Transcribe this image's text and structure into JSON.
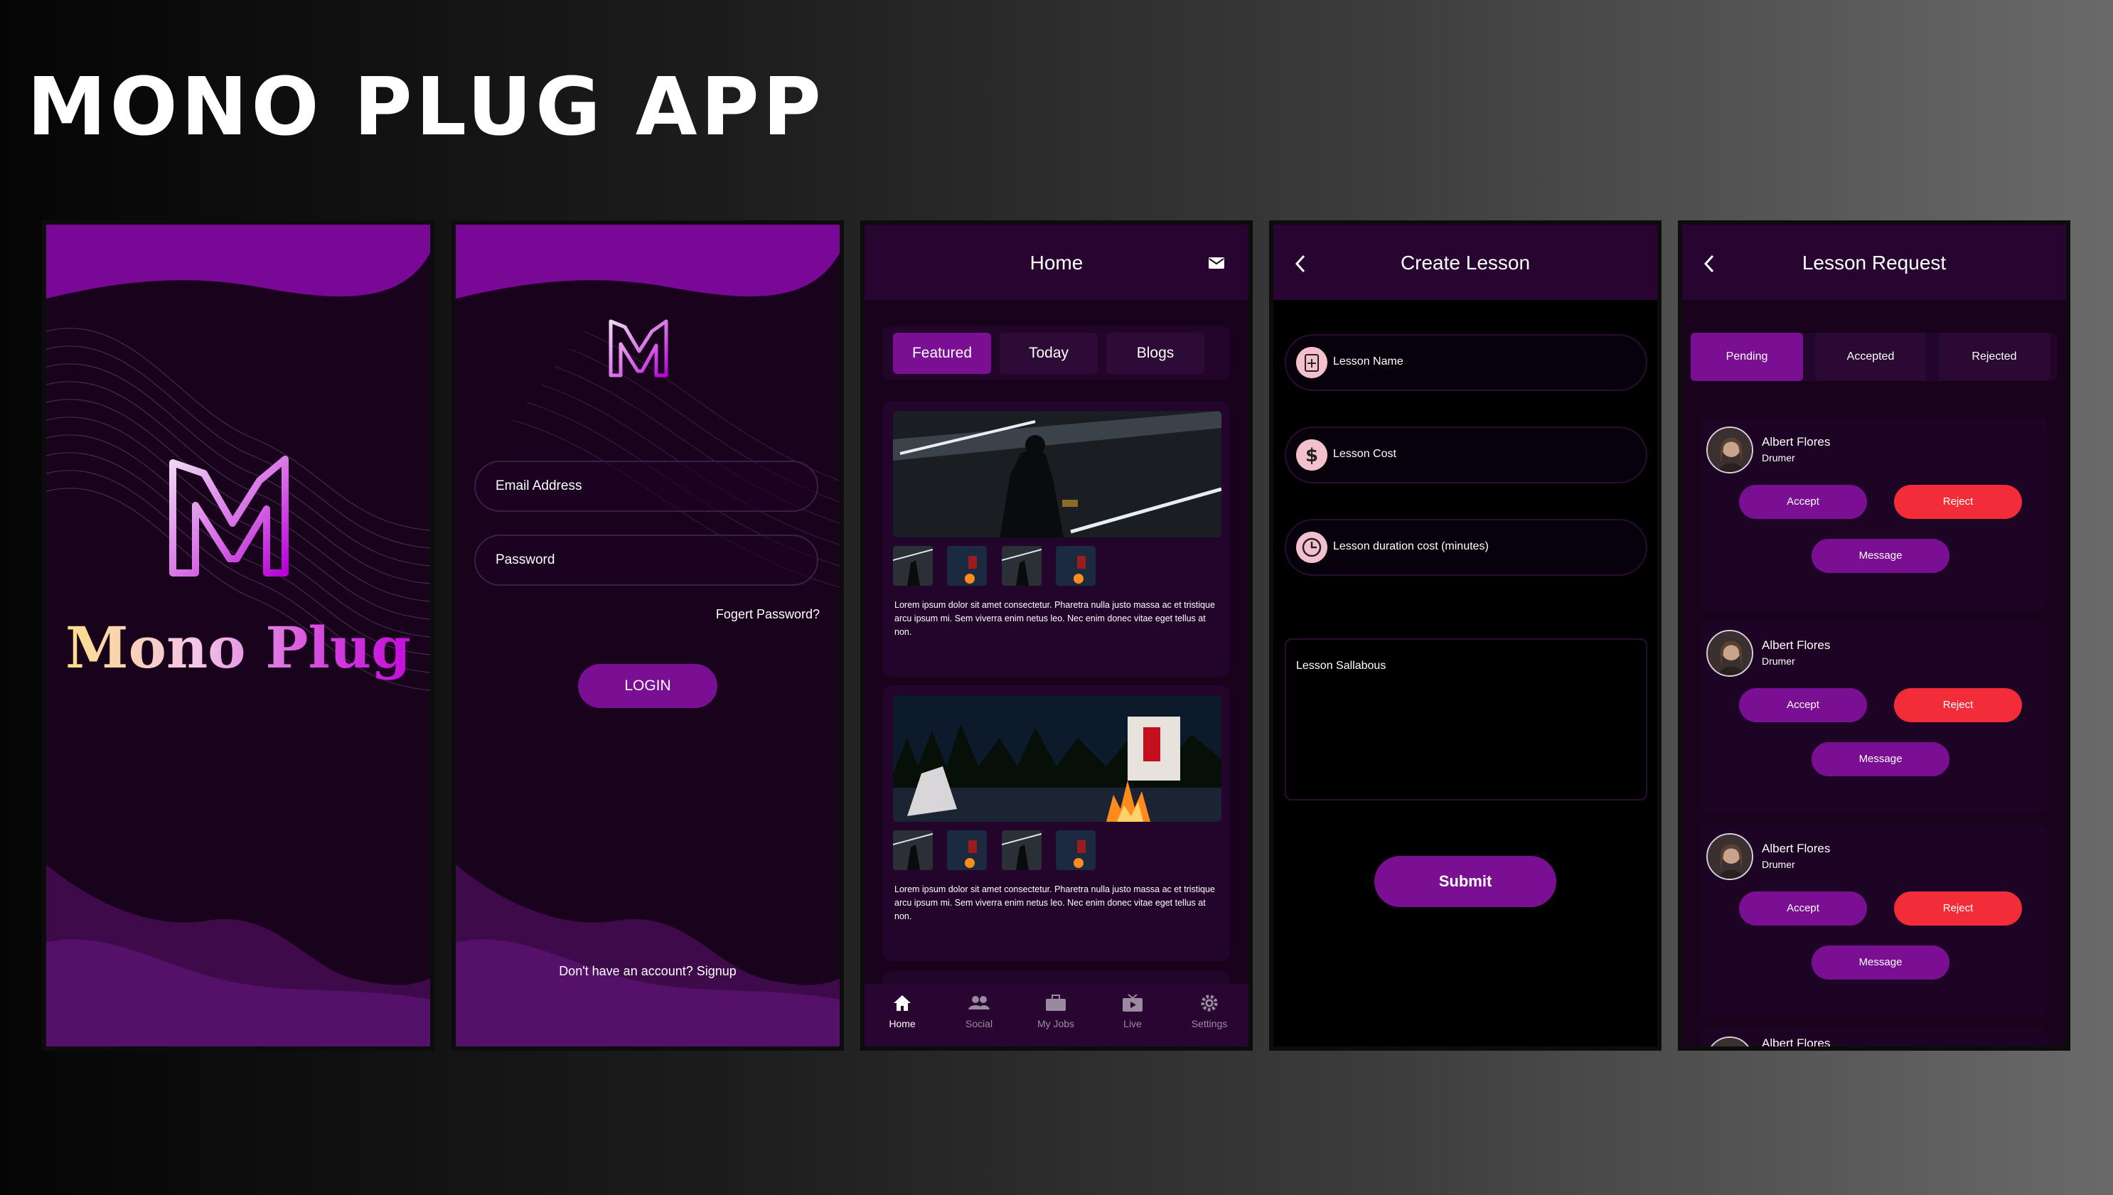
{
  "page_title": "MONO PLUG  APP",
  "splash": {
    "brand_name": "Mono Plug"
  },
  "login": {
    "email_placeholder": "Email Address",
    "password_placeholder": "Password",
    "forgot": "Fogert Password?",
    "login_button": "LOGIN",
    "signup_text": "Don't have an account? Signup"
  },
  "home": {
    "title": "Home",
    "tabs": [
      "Featured",
      "Today",
      "Blogs"
    ],
    "active_tab": "Featured",
    "cards": [
      {
        "text": "Lorem ipsum dolor sit amet consectetur. Pharetra nulla justo massa ac et tristique arcu ipsum mi. Sem viverra enim netus leo. Nec enim donec vitae eget tellus at non."
      },
      {
        "text": "Lorem ipsum dolor sit amet consectetur. Pharetra nulla justo massa ac et tristique arcu ipsum mi. Sem viverra enim netus leo. Nec enim donec vitae eget tellus at non."
      }
    ],
    "nav": [
      "Home",
      "Social",
      "My Jobs",
      "Live",
      "Settings"
    ]
  },
  "create_lesson": {
    "title": "Create Lesson",
    "fields": [
      "Lesson Name",
      "Lesson Cost",
      "Lesson duration cost (minutes)"
    ],
    "syllabus": "Lesson Sallabous",
    "submit": "Submit"
  },
  "lesson_request": {
    "title": "Lesson Request",
    "tabs": [
      "Pending",
      "Accepted",
      "Rejected"
    ],
    "requests": [
      {
        "name": "Albert Flores",
        "role": "Drumer"
      },
      {
        "name": "Albert Flores",
        "role": "Drumer"
      },
      {
        "name": "Albert Flores",
        "role": "Drumer"
      },
      {
        "name": "Albert Flores"
      }
    ],
    "accept": "Accept",
    "reject": "Reject",
    "message": "Message"
  },
  "colors": {
    "purple": "#7b0f93",
    "dark_bg": "#18021c",
    "reject_red": "#f22d39"
  }
}
